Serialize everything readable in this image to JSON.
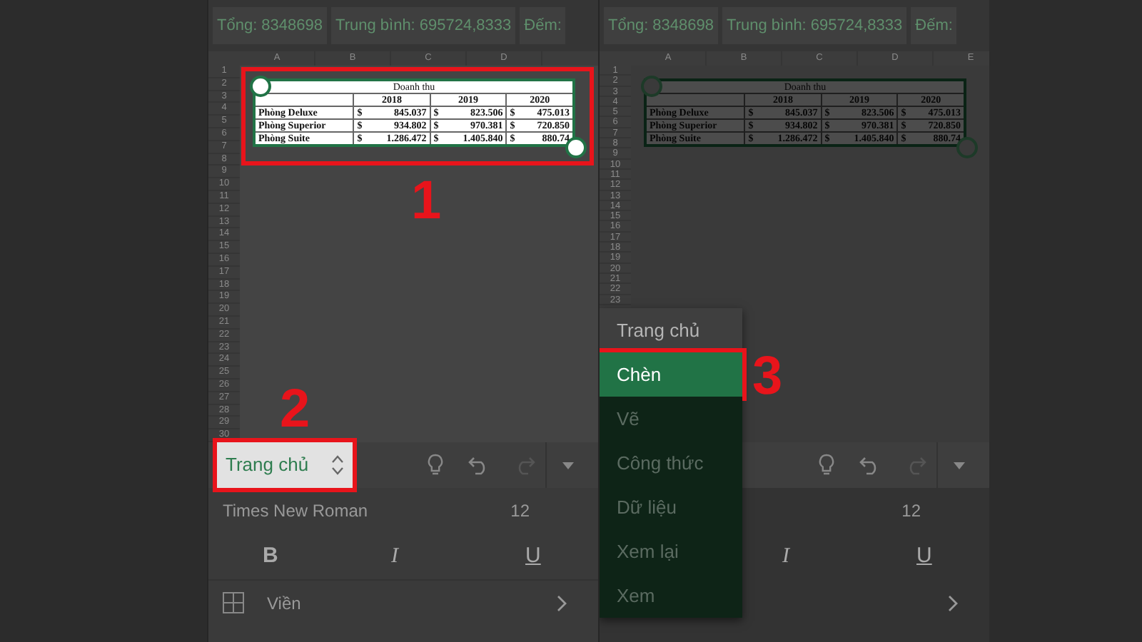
{
  "panels": [
    {
      "dimmed": false,
      "status_chips": [
        "Tổng: 8348698",
        "Trung bình: 695724,8333",
        "Đếm:"
      ],
      "columns": [
        "A",
        "B",
        "C",
        "D"
      ],
      "rows": [
        "1",
        "2",
        "3",
        "4",
        "5",
        "6",
        "7",
        "8",
        "9",
        "10",
        "11",
        "12",
        "13",
        "14",
        "15",
        "16",
        "17",
        "18",
        "19",
        "20",
        "21",
        "22",
        "23",
        "24",
        "25",
        "26",
        "27",
        "28",
        "29",
        "30"
      ],
      "table": {
        "title": "Doanh thu",
        "callout": "1",
        "years": [
          "2018",
          "2019",
          "2020"
        ],
        "rows": [
          {
            "label": "Phòng Deluxe",
            "cells": [
              "$",
              "845.037",
              "$",
              "823.506",
              "$",
              "475.013"
            ]
          },
          {
            "label": "Phòng Superior",
            "cells": [
              "$",
              "934.802",
              "$",
              "970.381",
              "$",
              "720.850"
            ]
          },
          {
            "label": "Phòng Suite",
            "cells": [
              "$",
              "1.286.472",
              "$",
              "1.405.840",
              "$",
              "880.74"
            ]
          }
        ]
      },
      "toolbar": {
        "selector": "Trang chủ",
        "selector_callout": "2",
        "font_name": "Times New Roman",
        "font_size": "12",
        "bold": "B",
        "italic": "I",
        "underline": "U",
        "border_label": "Viền"
      }
    },
    {
      "dimmed": true,
      "status_chips": [
        "Tổng: 8348698",
        "Trung bình: 695724,8333",
        "Đếm:"
      ],
      "columns": [
        "A",
        "B",
        "C",
        "D",
        "E"
      ],
      "rows": [
        "1",
        "2",
        "3",
        "4",
        "5",
        "6",
        "7",
        "8",
        "9",
        "10",
        "11",
        "12",
        "13",
        "14",
        "15",
        "16",
        "17",
        "18",
        "19",
        "20",
        "21",
        "22",
        "23"
      ],
      "table": {
        "title": "Doanh thu",
        "years": [
          "2018",
          "2019",
          "2020"
        ],
        "rows": [
          {
            "label": "Phòng Deluxe",
            "cells": [
              "$",
              "845.037",
              "$",
              "823.506",
              "$",
              "475.013"
            ]
          },
          {
            "label": "Phòng Superior",
            "cells": [
              "$",
              "934.802",
              "$",
              "970.381",
              "$",
              "720.850"
            ]
          },
          {
            "label": "Phòng Suite",
            "cells": [
              "$",
              "1.286.472",
              "$",
              "1.405.840",
              "$",
              "880.74"
            ]
          }
        ]
      },
      "toolbar": {
        "font_size": "12",
        "italic": "I",
        "underline": "U"
      },
      "menu": {
        "items": [
          {
            "label": "Trang chủ",
            "selected": false,
            "dimmed": false
          },
          {
            "label": "Chèn",
            "selected": true,
            "dimmed": false,
            "callout": "3"
          },
          {
            "label": "Vẽ",
            "selected": false,
            "dimmed": true
          },
          {
            "label": "Công thức",
            "selected": false,
            "dimmed": true
          },
          {
            "label": "Dữ liệu",
            "selected": false,
            "dimmed": true
          },
          {
            "label": "Xem lại",
            "selected": false,
            "dimmed": true
          },
          {
            "label": "Xem",
            "selected": false,
            "dimmed": true
          }
        ]
      }
    }
  ]
}
